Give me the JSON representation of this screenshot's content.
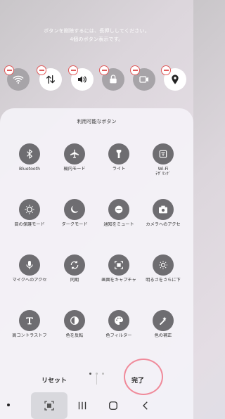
{
  "instructions": {
    "line1": "ボタンを削除するには、長押ししてください。",
    "line2": "4個のボタン表示です。"
  },
  "quick_buttons": [
    {
      "icon": "wifi-icon",
      "active": false
    },
    {
      "icon": "data-transfer-icon",
      "active": true
    },
    {
      "icon": "volume-icon",
      "active": true
    },
    {
      "icon": "lock-icon",
      "active": false
    },
    {
      "icon": "screen-record-icon",
      "active": false
    },
    {
      "icon": "location-icon",
      "active": true
    }
  ],
  "panel": {
    "title": "利用可能なボタン",
    "tiles": [
      {
        "label": "Bluetooth",
        "icon": "bluetooth-icon"
      },
      {
        "label": "機内モード",
        "icon": "airplane-icon"
      },
      {
        "label": "ライト",
        "icon": "flashlight-icon"
      },
      {
        "label": "Wi-Fi",
        "label2": "ﾃｻﾞﾘﾝｸﾞ",
        "icon": "hotspot-icon"
      },
      {
        "label": "目の保護モード",
        "icon": "eye-comfort-icon"
      },
      {
        "label": "ダークモード",
        "icon": "moon-icon"
      },
      {
        "label": "通知をミュート",
        "icon": "mute-icon"
      },
      {
        "label": "カメラへのアクセ",
        "icon": "camera-icon"
      },
      {
        "label": "マイクへのアクセ",
        "icon": "mic-icon"
      },
      {
        "label": "同期",
        "icon": "sync-icon"
      },
      {
        "label": "画面をキャプチャ",
        "icon": "screenshot-icon"
      },
      {
        "label": "明るさをさらに下",
        "icon": "extra-dim-icon"
      },
      {
        "label": "高コントラストフ",
        "icon": "high-contrast-font-icon"
      },
      {
        "label": "色を反転",
        "icon": "invert-color-icon"
      },
      {
        "label": "色フィルター",
        "icon": "color-filter-icon"
      },
      {
        "label": "色の補正",
        "icon": "color-correction-icon"
      }
    ]
  },
  "actions": {
    "reset_label": "リセット",
    "done_label": "完了"
  },
  "colors": {
    "tile_bg": "#6e6d71",
    "annotation_circle": "#f08a9a",
    "remove_badge": "#e05a5a"
  }
}
